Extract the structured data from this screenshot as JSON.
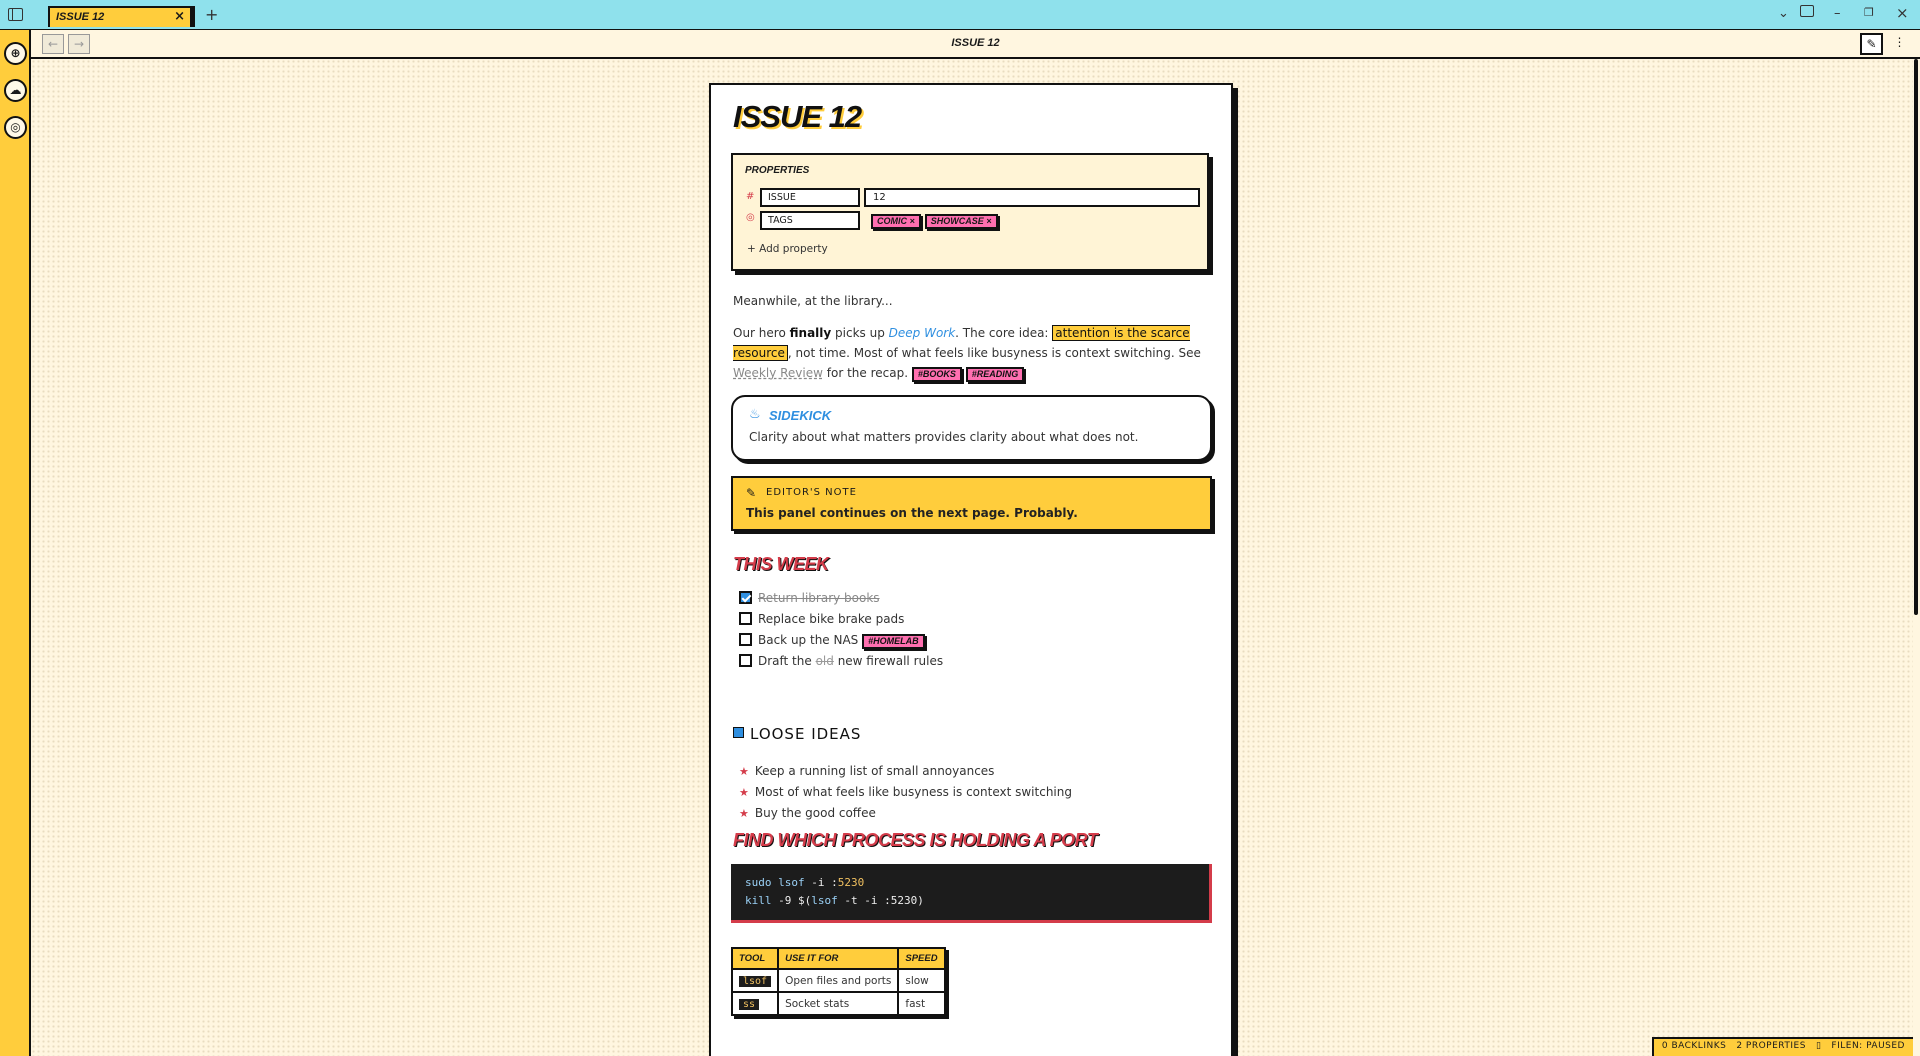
{
  "tab": {
    "label": "ISSUE 12"
  },
  "toolbar": {
    "view_title": "ISSUE 12",
    "back": "←",
    "forward": "→"
  },
  "note": {
    "title": "ISSUE 12",
    "properties": {
      "heading": "PROPERTIES",
      "rows": [
        {
          "icon": "number-icon",
          "key": "ISSUE",
          "value": "12"
        },
        {
          "icon": "tags-icon",
          "key": "TAGS",
          "tags": [
            "COMIC",
            "SHOWCASE"
          ]
        }
      ],
      "add_label": "Add property"
    },
    "intro": "Meanwhile, at the library...",
    "para": {
      "p1": "Our hero ",
      "bold": "finally",
      "p2": " picks up ",
      "link": "Deep Work",
      "p3": ". The core idea: ",
      "highlight": "attention is the scarce resource",
      "p4": ", not time. Most of what feels like busyness is context switching. See ",
      "unresolved": "Weekly Review",
      "p5": " for the recap. ",
      "tags": [
        "#BOOKS",
        "#READING"
      ]
    },
    "sidekick": {
      "title": "SIDEKICK",
      "body": "Clarity about what matters provides clarity about what does not."
    },
    "editors_note": {
      "title": "EDITOR'S NOTE",
      "body": "This panel continues on the next page. Probably."
    },
    "this_week": {
      "heading": "THIS WEEK",
      "tasks": [
        {
          "text": "Return library books",
          "done": true
        },
        {
          "text": "Replace bike brake pads",
          "done": false
        },
        {
          "text": "Back up the NAS",
          "done": false,
          "tag": "#HOMELAB"
        },
        {
          "pre": "Draft the ",
          "strike": "old",
          "post": " new firewall rules",
          "done": false
        }
      ]
    },
    "loose_ideas": {
      "heading": "LOOSE IDEAS",
      "items": [
        "Keep a running list of small annoyances",
        "Most of what feels like busyness is context switching",
        "Buy the good coffee"
      ]
    },
    "port_section": {
      "heading": "FIND WHICH PROCESS IS HOLDING A PORT",
      "code": {
        "l1_cmd": "sudo",
        "l1_tool": "lsof",
        "l1_flag": " -i :",
        "l1_port": "5230",
        "l2_cmd": "kill",
        "l2_flag": " -9 $(",
        "l2_tool": "lsof",
        "l2_rest": " -t -i :5230)"
      }
    },
    "table": {
      "headers": [
        "TOOL",
        "USE IT FOR",
        "SPEED"
      ],
      "rows": [
        {
          "tool": "lsof",
          "use": "Open files and ports",
          "speed": "slow"
        },
        {
          "tool": "ss",
          "use": "Socket stats",
          "speed": "fast"
        }
      ]
    }
  },
  "status": {
    "backlinks": "0 BACKLINKS",
    "properties": "2 PROPERTIES",
    "filen": "FILEN: PAUSED"
  },
  "colors": {
    "accent_yellow": "#ffcd3c",
    "titlebar_cyan": "#8fe1ec",
    "tag_pink": "#ff6fb0",
    "heading_red": "#d43c4a",
    "link_blue": "#2f8fe0"
  }
}
